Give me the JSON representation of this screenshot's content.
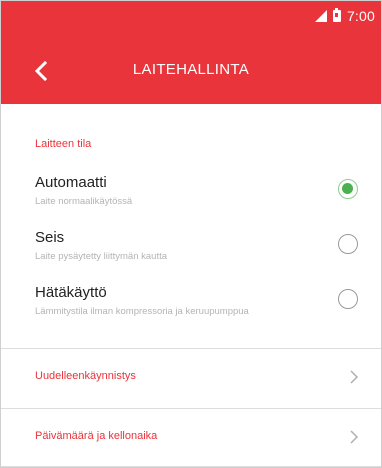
{
  "status_bar": {
    "time": "7:00",
    "icons": [
      "signal-icon",
      "battery-icon"
    ]
  },
  "header": {
    "back_icon": "chevron-left-icon",
    "title": "LAITEHALLINTA"
  },
  "colors": {
    "accent": "#e8343a",
    "selected": "#4caf50",
    "subtitle": "#b4b4b4"
  },
  "device_state": {
    "section_label": "Laitteen tila",
    "options": [
      {
        "title": "Automaatti",
        "subtitle": "Laite normaalikäytössä",
        "selected": true
      },
      {
        "title": "Seis",
        "subtitle": "Laite pysäytetty liittymän kautta",
        "selected": false
      },
      {
        "title": "Hätäkäyttö",
        "subtitle": "Lämmitystila ilman kompressoria ja keruupumppua",
        "selected": false
      }
    ]
  },
  "nav_items": [
    {
      "label": "Uudelleenkäynnistys",
      "icon": "chevron-right-icon"
    },
    {
      "label": "Päivämäärä ja kellonaika",
      "icon": "chevron-right-icon"
    }
  ]
}
